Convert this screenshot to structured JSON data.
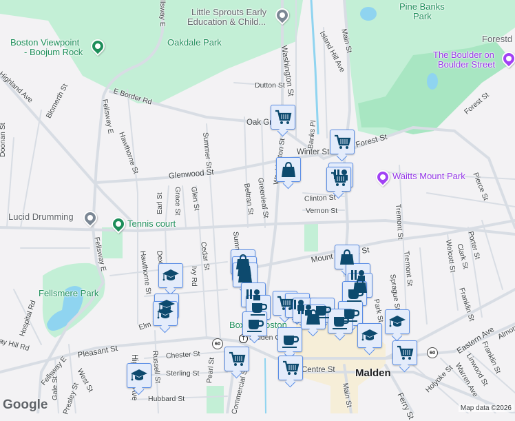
{
  "map": {
    "colors": {
      "background": "#f3f2f4",
      "park": "#c3efd6",
      "park_dark": "#a8e6c2",
      "water": "#8fd4f0",
      "road": "#d8dde4",
      "marker_bg": "#e4ecfb",
      "marker_border": "#5b8ee6",
      "marker_icon": "#0d4a6e",
      "downtown": "#f6eed8"
    },
    "places": {
      "little_sprouts_1": "Little Sprouts Early",
      "little_sprouts_2": "Education & Child...",
      "oakdale_park": "Oakdale Park",
      "boston_viewpoint_1": "Boston Viewpoint",
      "boston_viewpoint_2": "- Boojum Rock",
      "pine_banks_1": "Pine Banks",
      "pine_banks_2": "Park",
      "forestdale": "Forestd",
      "boulder_1": "The Boulder on",
      "boulder_2": "Boulder Street",
      "waitts": "Waitts Mount Park",
      "lucid": "Lucid Drumming",
      "tennis": "Tennis court",
      "fellsmere": "Fellsmere Park",
      "boxing": "Boxing Boston",
      "malden_center": "Malden Center",
      "malden": "Malden"
    },
    "streets": {
      "e_border": "E Border Rd",
      "fellsway_top": "Fellsway E",
      "fellsway_1": "Fellsway E",
      "fellsway_2": "Fellsway E",
      "fellsway_3": "Fellsway E",
      "highland_top": "Highland Ave",
      "blomerth": "Blomerth St",
      "doonan": "Doonan St",
      "hawthorne_1": "Hawthorne St",
      "hawthorne_2": "Hawthorne St",
      "summer_1": "Summer St",
      "summer_2": "Summer St",
      "glenwood": "Glenwood St",
      "earl": "Earl St",
      "grace": "Grace St",
      "glen": "Glen St",
      "beltran": "Beltran St",
      "greenleaf": "Greenleaf St",
      "washington_1": "Washington St",
      "washington_2": "Washington St",
      "dutton": "Dutton St",
      "oak_grove": "Oak Grove",
      "island_hill": "Island Hill Ave",
      "main_1": "Main St",
      "main_2": "Main St",
      "banks": "Banks Pl",
      "winter": "Winter St",
      "forest_1": "Forest St",
      "forest_2": "Forest St",
      "pierce": "Pierce St",
      "clinton": "Clinton St",
      "vernon": "Vernon St",
      "tremont_1": "Tremont St",
      "tremont_2": "Tremont St",
      "porter": "Porter St",
      "clark": "Clark St",
      "wolcott": "Wolcott St",
      "franklin_1": "Franklin St",
      "franklin_2": "Franklin St",
      "sprague": "Sprague St",
      "park": "Park St",
      "mount_vernon": "Mount Vernon St",
      "eastern": "Eastern Ave",
      "linwood": "Linwood St",
      "warren": "Warren Ave",
      "holyoke": "Holyoke St",
      "almont": "Almont St",
      "ferry": "Ferry St",
      "centre": "Centre St",
      "commercial": "Commercial St",
      "pleasant": "Pleasant St",
      "chester": "Chester St",
      "sterling": "Sterling St",
      "hubbard": "Hubbard St",
      "pearl": "Pearl St",
      "russell": "Russell St",
      "highland_bottom": "Highland Ave",
      "west": "West St",
      "presley": "Presley St",
      "gale": "Gale St",
      "murray_hill": "Murray Hill Rd",
      "hospital": "Hospital Rd",
      "elm": "Elm St",
      "dexter": "Dexter St",
      "ivy": "Ivy Rd",
      "cedar": "Cedar St"
    },
    "route_shields": [
      "60",
      "60"
    ],
    "transit_symbol": "T",
    "logo": "Google",
    "attribution": "Map data ©2026",
    "marker_types": [
      "shopping-cart",
      "shopping-bag",
      "coffee-cup",
      "graduation-cap",
      "ticket"
    ]
  }
}
